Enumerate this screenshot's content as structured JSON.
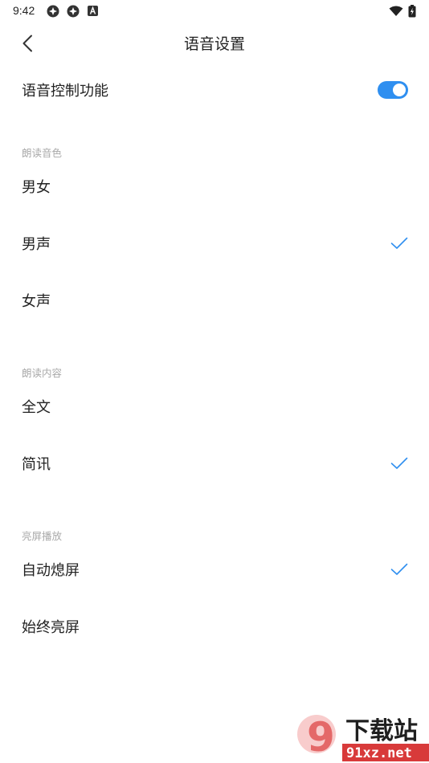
{
  "status_bar": {
    "time": "9:42"
  },
  "header": {
    "title": "语音设置",
    "back_icon": "chevron-left-icon"
  },
  "voice_control": {
    "label": "语音控制功能",
    "enabled": true,
    "accent_color": "#2f8ff0"
  },
  "sections": {
    "voice_timbre": {
      "title": "朗读音色",
      "options": [
        {
          "label": "男女",
          "selected": false
        },
        {
          "label": "男声",
          "selected": true
        },
        {
          "label": "女声",
          "selected": false
        }
      ]
    },
    "read_content": {
      "title": "朗读内容",
      "options": [
        {
          "label": "全文",
          "selected": false
        },
        {
          "label": "简讯",
          "selected": true
        }
      ]
    },
    "screen_play": {
      "title": "亮屏播放",
      "options": [
        {
          "label": "自动熄屏",
          "selected": true
        },
        {
          "label": "始终亮屏",
          "selected": false
        }
      ]
    }
  },
  "watermark": {
    "logo_text": "9",
    "title": "下载站",
    "url": "91xz.net"
  }
}
